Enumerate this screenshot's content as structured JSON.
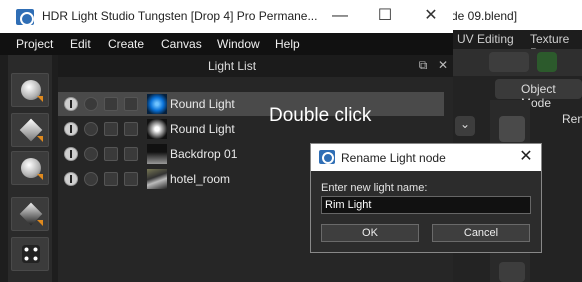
{
  "blender": {
    "title_fragment": "de 09.blend]",
    "tabs": [
      "UV Editing",
      "Texture Pa"
    ],
    "header_button": "Object Mode",
    "side_text": "Ren"
  },
  "hdr_window": {
    "title": "HDR Light Studio Tungsten [Drop 4]  Pro Permane...",
    "controls": {
      "minimize": "—",
      "maximize": "☐",
      "close": "✕"
    },
    "menu": [
      "Project",
      "Edit",
      "Create",
      "Canvas",
      "Window",
      "Help"
    ],
    "panel": {
      "title": "Light List",
      "float_icon": "⧉",
      "close_icon": "✕"
    },
    "lights": [
      {
        "name": "Round Light",
        "thumb": "blue-round",
        "selected": true
      },
      {
        "name": "Round Light",
        "thumb": "white-round",
        "selected": false
      },
      {
        "name": "Backdrop 01",
        "thumb": "backdrop",
        "selected": false
      },
      {
        "name": "hotel_room",
        "thumb": "hotel",
        "selected": false
      }
    ],
    "toolbar_icons": [
      "round-light-icon",
      "rect-light-icon",
      "spot-light-icon",
      "panel-light-icon",
      "pattern-light-icon"
    ]
  },
  "hint_text": "Double click",
  "dialog": {
    "title": "Rename Light node",
    "close": "✕",
    "prompt": "Enter new light name:",
    "value": "Rim Light",
    "ok": "OK",
    "cancel": "Cancel"
  },
  "colors": {
    "accent_blue": "#2f6eb5",
    "selection": "#4a4a4a",
    "orange_arrow": "#e08a1e"
  }
}
